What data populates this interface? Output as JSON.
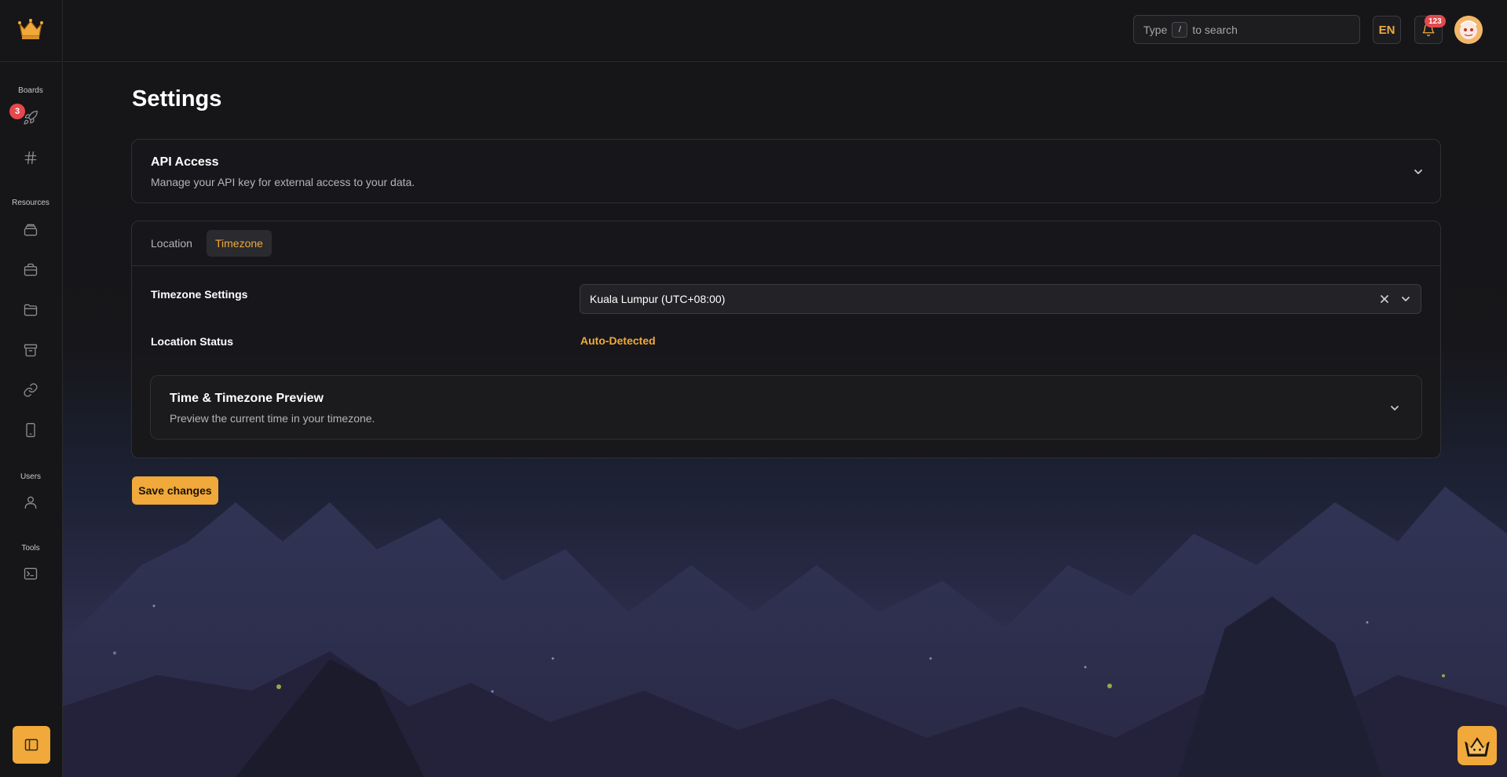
{
  "sidebar": {
    "logo_icon": "crown-icon",
    "sections": {
      "boards": "Boards",
      "resources": "Resources",
      "users": "Users",
      "tools": "Tools"
    },
    "boards_badge": "3",
    "items": [
      {
        "icon": "rocket-icon"
      },
      {
        "icon": "hash-icon"
      },
      {
        "icon": "layers-icon"
      },
      {
        "icon": "briefcase-icon"
      },
      {
        "icon": "folder-icon"
      },
      {
        "icon": "archive-icon"
      },
      {
        "icon": "link-icon"
      },
      {
        "icon": "smartphone-icon"
      },
      {
        "icon": "user-icon"
      },
      {
        "icon": "terminal-icon"
      }
    ],
    "collapse_icon": "sidebar-panel-icon"
  },
  "header": {
    "search": {
      "prefix": "Type",
      "key": "/",
      "suffix": "to search"
    },
    "language": "EN",
    "notifications_count": "123",
    "bell_icon": "bell-icon"
  },
  "page": {
    "title": "Settings",
    "api_access": {
      "title": "API Access",
      "description": "Manage your API key for external access to your data."
    },
    "tabs": [
      "Location",
      "Timezone"
    ],
    "active_tab": "Timezone",
    "timezone_settings_label": "Timezone Settings",
    "timezone_value": "Kuala Lumpur (UTC+08:00)",
    "location_status_label": "Location Status",
    "location_status_value": "Auto-Detected",
    "preview": {
      "title": "Time & Timezone Preview",
      "description": "Preview the current time in your timezone."
    },
    "save_label": "Save changes"
  },
  "colors": {
    "accent": "#f0a93a",
    "badge": "#e5484d",
    "background": "#141416",
    "card": "#18181b"
  }
}
